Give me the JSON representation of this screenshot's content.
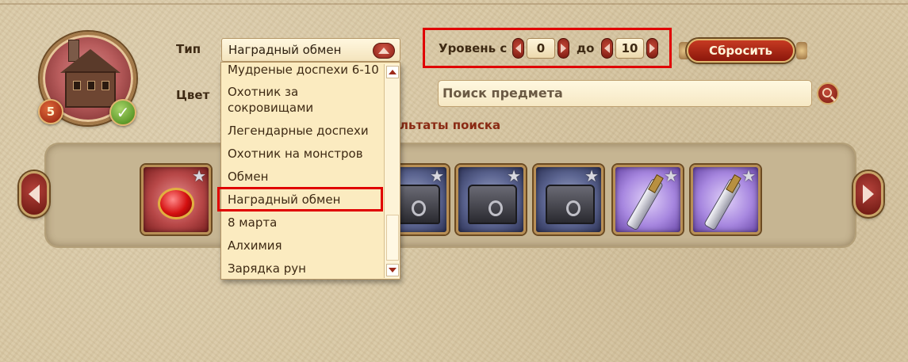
{
  "profile": {
    "level": "5",
    "verified_icon": "check-icon"
  },
  "filters": {
    "type_label": "Тип",
    "color_label": "Цвет",
    "type_value": "Наградный обмен",
    "type_options": [
      "Мудреные доспехи 6-10",
      "Охотник за сокровищами",
      "Легендарные доспехи",
      "Охотник на монстров",
      "Обмен",
      "Наградный обмен",
      "8 марта",
      "Алхимия",
      "Зарядка рун"
    ],
    "selected_index": 5,
    "level_label_from": "Уровень с",
    "level_label_to": "до",
    "level_from": "0",
    "level_to": "10",
    "reset_label": "Сбросить",
    "search_placeholder": "Поиск предмета",
    "results_label": "льтаты поиска"
  },
  "items": [
    {
      "kind": "ruby-amulet",
      "rarity": "red"
    },
    {
      "kind": "iron-chest",
      "rarity": "blue"
    },
    {
      "kind": "iron-chest",
      "rarity": "blue"
    },
    {
      "kind": "iron-chest",
      "rarity": "blue"
    },
    {
      "kind": "dagger",
      "rarity": "purple"
    },
    {
      "kind": "dagger",
      "rarity": "purple"
    }
  ],
  "colors": {
    "accent_red": "#8b170b",
    "highlight": "#e00000",
    "parchment": "#d9c8a4"
  }
}
